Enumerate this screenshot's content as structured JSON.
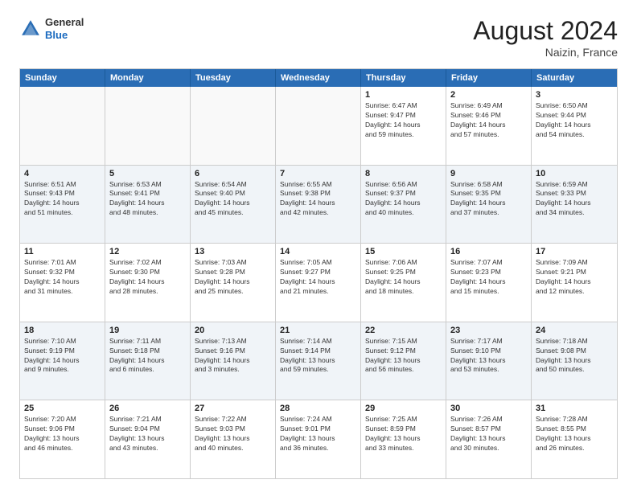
{
  "header": {
    "logo": {
      "general": "General",
      "blue": "Blue"
    },
    "month_year": "August 2024",
    "location": "Naizin, France"
  },
  "days_of_week": [
    "Sunday",
    "Monday",
    "Tuesday",
    "Wednesday",
    "Thursday",
    "Friday",
    "Saturday"
  ],
  "weeks": [
    {
      "cells": [
        {
          "day": "",
          "content": "",
          "empty": true
        },
        {
          "day": "",
          "content": "",
          "empty": true
        },
        {
          "day": "",
          "content": "",
          "empty": true
        },
        {
          "day": "",
          "content": "",
          "empty": true
        },
        {
          "day": "1",
          "content": "Sunrise: 6:47 AM\nSunset: 9:47 PM\nDaylight: 14 hours\nand 59 minutes.",
          "empty": false
        },
        {
          "day": "2",
          "content": "Sunrise: 6:49 AM\nSunset: 9:46 PM\nDaylight: 14 hours\nand 57 minutes.",
          "empty": false
        },
        {
          "day": "3",
          "content": "Sunrise: 6:50 AM\nSunset: 9:44 PM\nDaylight: 14 hours\nand 54 minutes.",
          "empty": false
        }
      ]
    },
    {
      "cells": [
        {
          "day": "4",
          "content": "Sunrise: 6:51 AM\nSunset: 9:43 PM\nDaylight: 14 hours\nand 51 minutes.",
          "empty": false
        },
        {
          "day": "5",
          "content": "Sunrise: 6:53 AM\nSunset: 9:41 PM\nDaylight: 14 hours\nand 48 minutes.",
          "empty": false
        },
        {
          "day": "6",
          "content": "Sunrise: 6:54 AM\nSunset: 9:40 PM\nDaylight: 14 hours\nand 45 minutes.",
          "empty": false
        },
        {
          "day": "7",
          "content": "Sunrise: 6:55 AM\nSunset: 9:38 PM\nDaylight: 14 hours\nand 42 minutes.",
          "empty": false
        },
        {
          "day": "8",
          "content": "Sunrise: 6:56 AM\nSunset: 9:37 PM\nDaylight: 14 hours\nand 40 minutes.",
          "empty": false
        },
        {
          "day": "9",
          "content": "Sunrise: 6:58 AM\nSunset: 9:35 PM\nDaylight: 14 hours\nand 37 minutes.",
          "empty": false
        },
        {
          "day": "10",
          "content": "Sunrise: 6:59 AM\nSunset: 9:33 PM\nDaylight: 14 hours\nand 34 minutes.",
          "empty": false
        }
      ]
    },
    {
      "cells": [
        {
          "day": "11",
          "content": "Sunrise: 7:01 AM\nSunset: 9:32 PM\nDaylight: 14 hours\nand 31 minutes.",
          "empty": false
        },
        {
          "day": "12",
          "content": "Sunrise: 7:02 AM\nSunset: 9:30 PM\nDaylight: 14 hours\nand 28 minutes.",
          "empty": false
        },
        {
          "day": "13",
          "content": "Sunrise: 7:03 AM\nSunset: 9:28 PM\nDaylight: 14 hours\nand 25 minutes.",
          "empty": false
        },
        {
          "day": "14",
          "content": "Sunrise: 7:05 AM\nSunset: 9:27 PM\nDaylight: 14 hours\nand 21 minutes.",
          "empty": false
        },
        {
          "day": "15",
          "content": "Sunrise: 7:06 AM\nSunset: 9:25 PM\nDaylight: 14 hours\nand 18 minutes.",
          "empty": false
        },
        {
          "day": "16",
          "content": "Sunrise: 7:07 AM\nSunset: 9:23 PM\nDaylight: 14 hours\nand 15 minutes.",
          "empty": false
        },
        {
          "day": "17",
          "content": "Sunrise: 7:09 AM\nSunset: 9:21 PM\nDaylight: 14 hours\nand 12 minutes.",
          "empty": false
        }
      ]
    },
    {
      "cells": [
        {
          "day": "18",
          "content": "Sunrise: 7:10 AM\nSunset: 9:19 PM\nDaylight: 14 hours\nand 9 minutes.",
          "empty": false
        },
        {
          "day": "19",
          "content": "Sunrise: 7:11 AM\nSunset: 9:18 PM\nDaylight: 14 hours\nand 6 minutes.",
          "empty": false
        },
        {
          "day": "20",
          "content": "Sunrise: 7:13 AM\nSunset: 9:16 PM\nDaylight: 14 hours\nand 3 minutes.",
          "empty": false
        },
        {
          "day": "21",
          "content": "Sunrise: 7:14 AM\nSunset: 9:14 PM\nDaylight: 13 hours\nand 59 minutes.",
          "empty": false
        },
        {
          "day": "22",
          "content": "Sunrise: 7:15 AM\nSunset: 9:12 PM\nDaylight: 13 hours\nand 56 minutes.",
          "empty": false
        },
        {
          "day": "23",
          "content": "Sunrise: 7:17 AM\nSunset: 9:10 PM\nDaylight: 13 hours\nand 53 minutes.",
          "empty": false
        },
        {
          "day": "24",
          "content": "Sunrise: 7:18 AM\nSunset: 9:08 PM\nDaylight: 13 hours\nand 50 minutes.",
          "empty": false
        }
      ]
    },
    {
      "cells": [
        {
          "day": "25",
          "content": "Sunrise: 7:20 AM\nSunset: 9:06 PM\nDaylight: 13 hours\nand 46 minutes.",
          "empty": false
        },
        {
          "day": "26",
          "content": "Sunrise: 7:21 AM\nSunset: 9:04 PM\nDaylight: 13 hours\nand 43 minutes.",
          "empty": false
        },
        {
          "day": "27",
          "content": "Sunrise: 7:22 AM\nSunset: 9:03 PM\nDaylight: 13 hours\nand 40 minutes.",
          "empty": false
        },
        {
          "day": "28",
          "content": "Sunrise: 7:24 AM\nSunset: 9:01 PM\nDaylight: 13 hours\nand 36 minutes.",
          "empty": false
        },
        {
          "day": "29",
          "content": "Sunrise: 7:25 AM\nSunset: 8:59 PM\nDaylight: 13 hours\nand 33 minutes.",
          "empty": false
        },
        {
          "day": "30",
          "content": "Sunrise: 7:26 AM\nSunset: 8:57 PM\nDaylight: 13 hours\nand 30 minutes.",
          "empty": false
        },
        {
          "day": "31",
          "content": "Sunrise: 7:28 AM\nSunset: 8:55 PM\nDaylight: 13 hours\nand 26 minutes.",
          "empty": false
        }
      ]
    }
  ]
}
